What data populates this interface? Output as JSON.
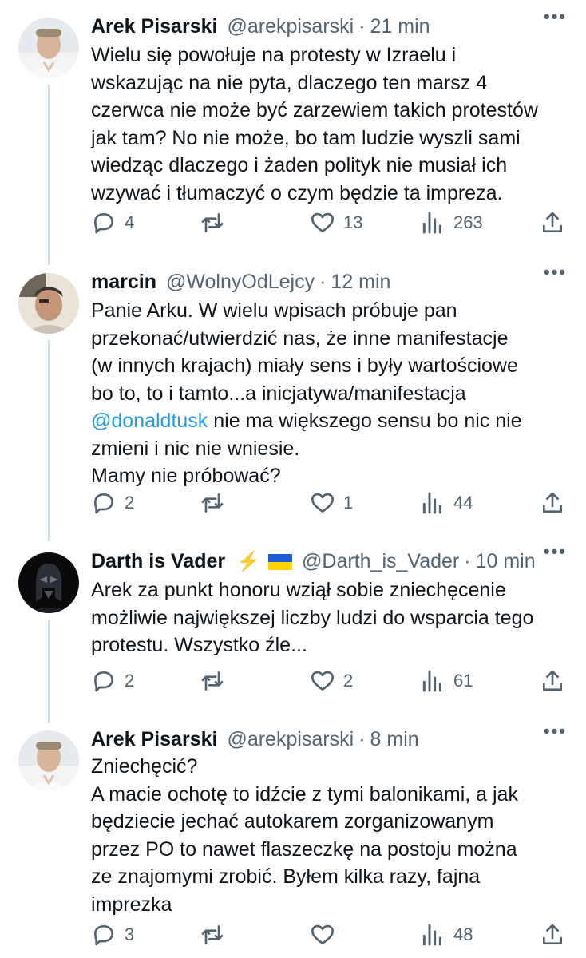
{
  "tweets": [
    {
      "name": "Arek Pisarski",
      "handle": "@arekpisarski",
      "time": "21 min",
      "text": "Wielu się powołuje na protesty w Izraelu i\nwskazując na nie pyta, dlaczego ten marsz 4\nczerwca nie może być zarzewiem takich protestów\njak tam? No nie może, bo tam ludzie wyszli sami\nwiedząc dlaczego i żaden polityk nie musiał ich\nwzywać i tłumaczyć o czym będzie ta impreza.",
      "replies": "4",
      "retweets": "",
      "likes": "13",
      "views": "263"
    },
    {
      "name": "marcin",
      "handle": "@WolnyOdLejcy",
      "time": "12 min",
      "text_before": "Panie Arku. W wielu wpisach próbuje pan\nprzekonać/utwierdzić nas, że inne manifestacje\n(w innych krajach) miały sens i były wartościowe\nbo to, to i tamto...a inicjatywa/manifestacja\n",
      "mention": "@donaldtusk",
      "text_after": " nie ma większego sensu bo nic nie\nzmieni i nic nie wniesie.\nMamy nie próbować?",
      "replies": "2",
      "retweets": "",
      "likes": "1",
      "views": "44"
    },
    {
      "name": "Darth is Vader",
      "emoji": "⚡",
      "handle": "@Darth_is_Vader",
      "time": "10 min",
      "text": "Arek za punkt honoru wziął sobie zniechęcenie\nmożliwie największej liczby ludzi do wsparcia tego\nprotestu. Wszystko źle...",
      "replies": "2",
      "retweets": "",
      "likes": "2",
      "views": "61"
    },
    {
      "name": "Arek Pisarski",
      "handle": "@arekpisarski",
      "time": "8 min",
      "text": "Zniechęcić?\nA macie ochotę to idźcie z tymi balonikami, a jak\nbędziecie jechać autokarem zorganizowanym\nprzez PO to nawet flaszeczkę na postoju można\nze znajomymi zrobić. Byłem kilka razy, fajna\nimprezka",
      "replies": "3",
      "retweets": "",
      "likes": "",
      "views": "48"
    }
  ],
  "ui": {
    "separator": "·",
    "more": "•••"
  },
  "colors": {
    "accent": "#1d9bf0",
    "muted": "#536471",
    "thread": "#cfd9de"
  },
  "icons": [
    "reply-icon",
    "retweet-icon",
    "like-icon",
    "views-icon",
    "share-icon",
    "more-icon"
  ]
}
